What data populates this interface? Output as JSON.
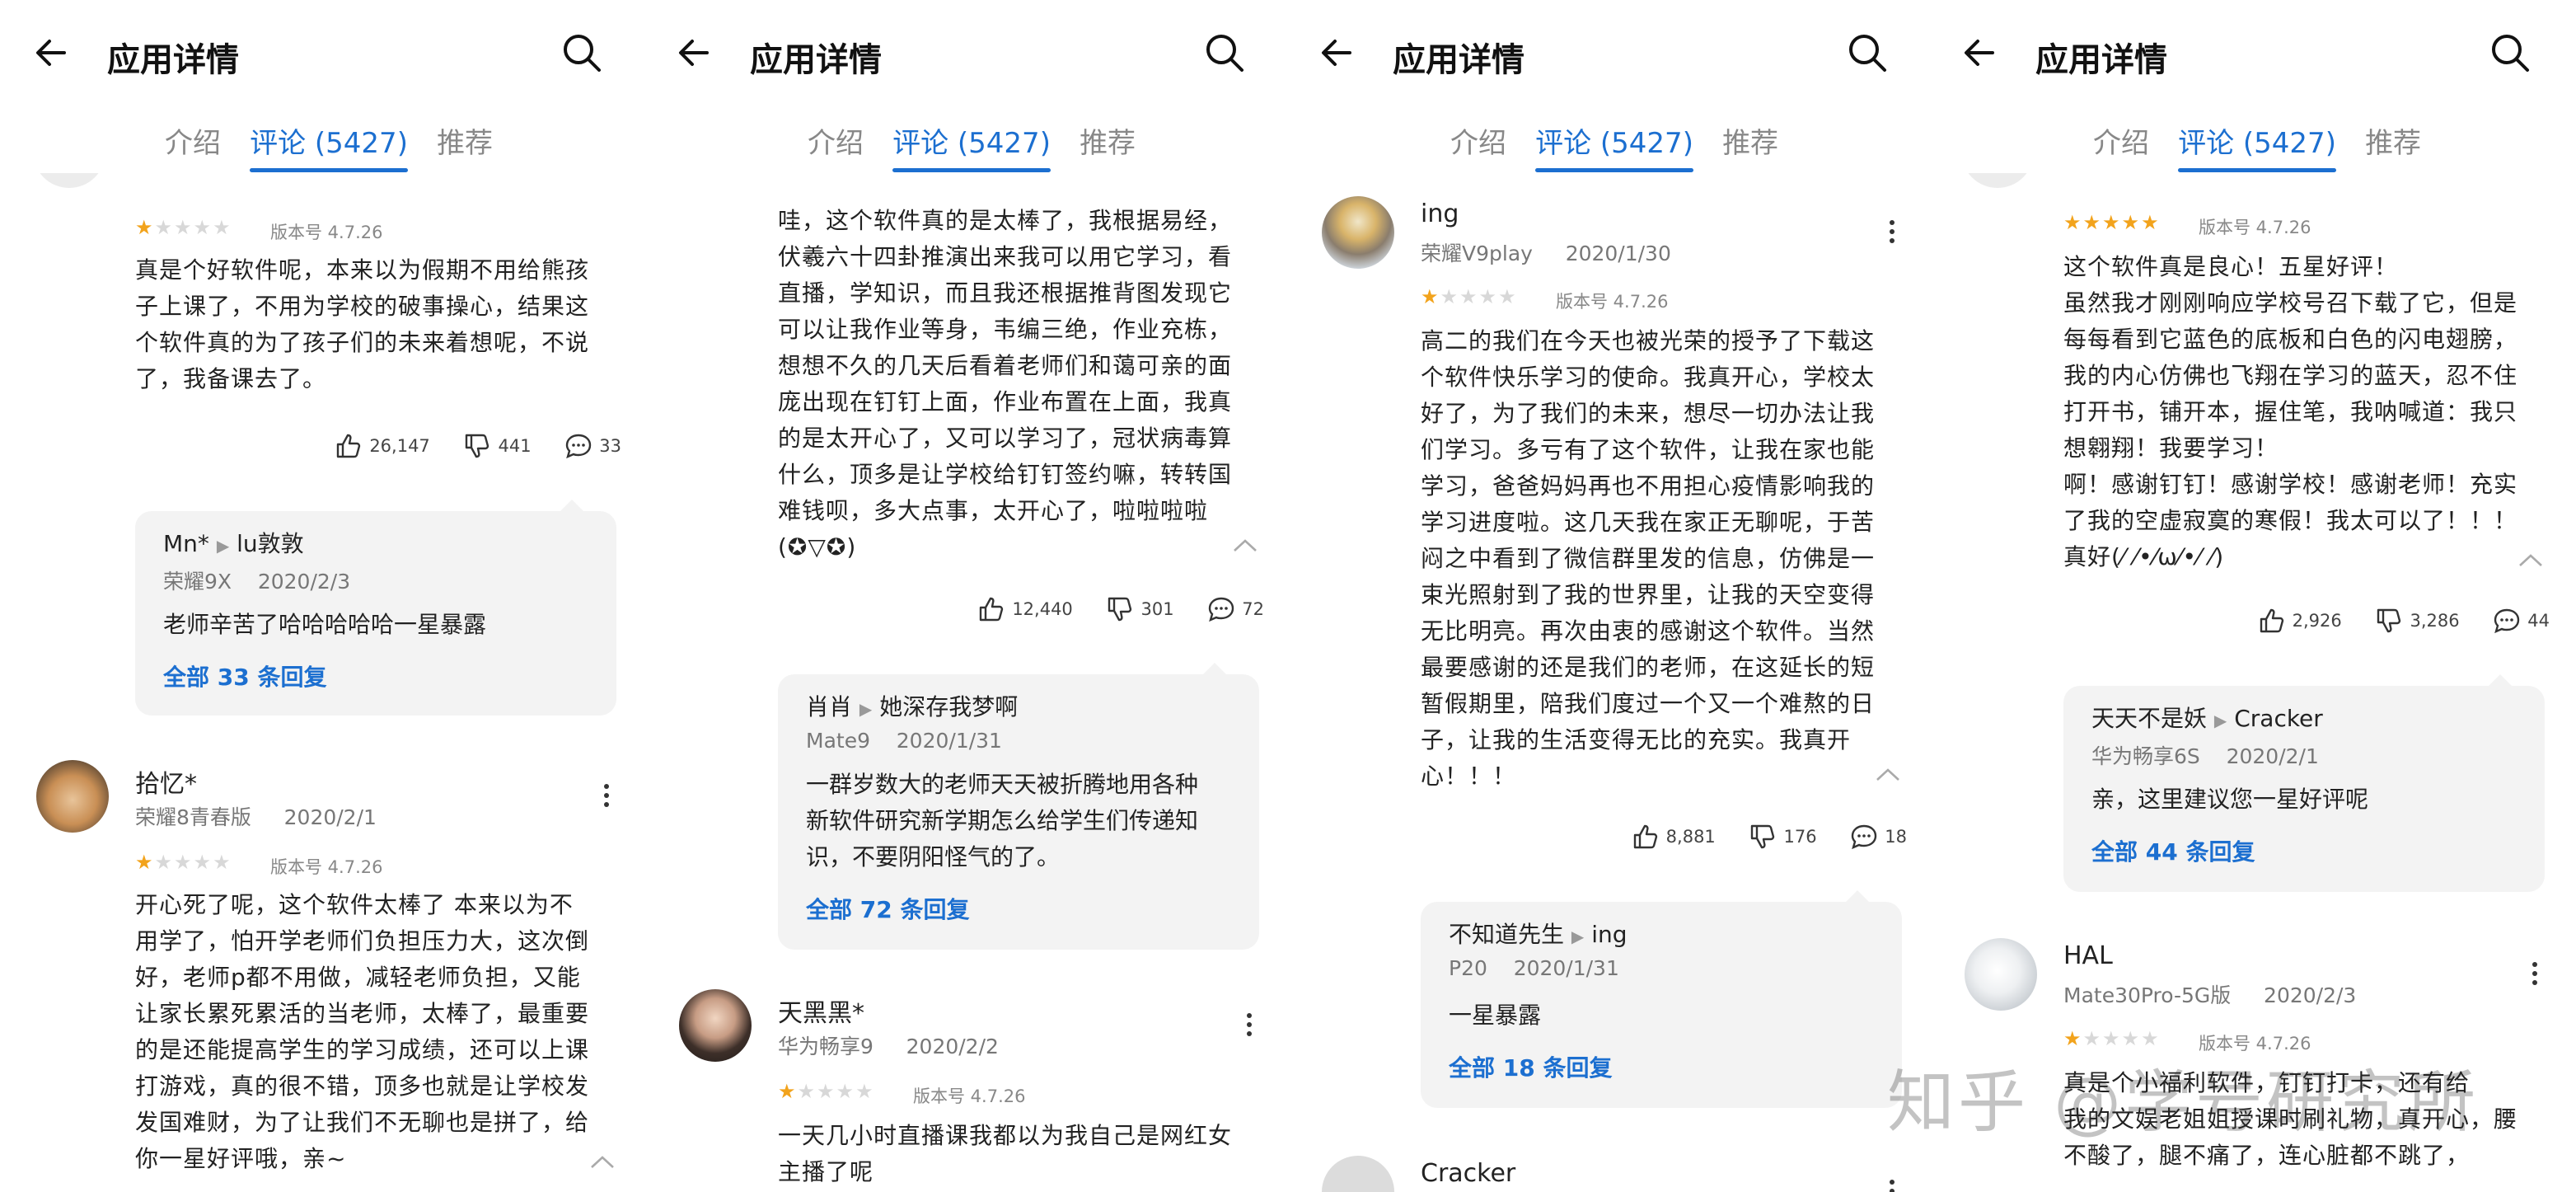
{
  "header": {
    "title": "应用详情"
  },
  "tabs": {
    "intro": "介绍",
    "reviews": "评论 (5427)",
    "recommend": "推荐"
  },
  "colors": {
    "accent": "#1c6fd0",
    "star": "#f2a31c",
    "reply_bg": "#f3f3f3"
  },
  "icons": {
    "back": "arrow-left",
    "search": "magnifier",
    "like": "thumbs-up",
    "dislike": "thumbs-down",
    "comment": "speech-bubble",
    "more": "vertical-dots"
  },
  "watermark": "知乎 @学号研究所",
  "panel1": {
    "r1": {
      "rating": 1,
      "version": "版本号 4.7.26",
      "text": "真是个好软件呢，本来以为假期不用给熊孩\n子上课了，不用为学校的破事操心，结果这\n个软件真的为了孩子们的未来着想呢，不说\n了，我备课去了。",
      "likes": "26,147",
      "dislikes": "441",
      "comments": "33",
      "reply": {
        "from": "Mn*",
        "to": "lu敦敦",
        "device": "荣耀9X",
        "date": "2020/2/3",
        "text": "老师辛苦了哈哈哈哈哈一星暴露",
        "all": "全部 33 条回复"
      }
    },
    "r2": {
      "name": "拾忆*",
      "device": "荣耀8青春版",
      "date": "2020/2/1",
      "rating": 1,
      "version": "版本号 4.7.26",
      "text": "开心死了呢，这个软件太棒了 本来以为不\n用学了，怕开学老师们负担压力大，这次倒\n好，老师p都不用做，减轻老师负担，又能\n让家长累死累活的当老师，太棒了，最重要\n的是还能提高学生的学习成绩，还可以上课\n打游戏，真的很不错，顶多也就是让学校发\n发国难财，为了让我们不无聊也是拼了，给\n你一星好评哦，亲~"
    }
  },
  "panel2": {
    "r1": {
      "text": "哇，这个软件真的是太棒了，我根据易经，\n伏羲六十四卦推演出来我可以用它学习，看\n直播，学知识，而且我还根据推背图发现它\n可以让我作业等身，韦编三绝，作业充栋，\n想想不久的几天后看着老师们和蔼可亲的面\n庞出现在钉钉上面，作业布置在上面，我真\n的是太开心了，又可以学习了，冠状病毒算\n什么，顶多是让学校给钉钉签约嘛，转转国\n难钱呗，多大点事，太开心了，啦啦啦啦\n(✪▽✪)",
      "likes": "12,440",
      "dislikes": "301",
      "comments": "72",
      "reply": {
        "from": "肖肖",
        "to": "她深存我梦啊",
        "device": "Mate9",
        "date": "2020/1/31",
        "text1": "一群岁数大的老师天天被折腾地用各种",
        "text2": "新软件研究新学期怎么给学生们传递知",
        "text3": "识，不要阴阳怪气的了。",
        "all": "全部 72 条回复"
      }
    },
    "r2": {
      "name": "天黑黑*",
      "device": "华为畅享9",
      "date": "2020/2/2",
      "rating": 1,
      "version": "版本号 4.7.26",
      "text": "一天几小时直播课我都以为我自己是网红女\n主播了呢"
    }
  },
  "panel3": {
    "r1": {
      "name": "ing",
      "device": "荣耀V9play",
      "date": "2020/1/30",
      "rating": 1,
      "version": "版本号 4.7.26",
      "text": "高二的我们在今天也被光荣的授予了下载这\n个软件快乐学习的使命。我真开心，学校太\n好了，为了我们的未来，想尽一切办法让我\n们学习。多亏有了这个软件，让我在家也能\n学习，爸爸妈妈再也不用担心疫情影响我的\n学习进度啦。这几天我在家正无聊呢，于苦\n闷之中看到了微信群里发的信息，仿佛是一\n束光照射到了我的世界里，让我的天空变得\n无比明亮。再次由衷的感谢这个软件。当然\n最要感谢的还是我们的老师，在这延长的短\n暂假期里，陪我们度过一个又一个难熬的日\n子，让我的生活变得无比的充实。我真开\n心！！！",
      "likes": "8,881",
      "dislikes": "176",
      "comments": "18",
      "reply": {
        "from": "不知道先生",
        "to": "ing",
        "device": "P20",
        "date": "2020/1/31",
        "text": "一星暴露",
        "all": "全部 18 条回复"
      }
    },
    "r2": {
      "name": "Cracker"
    }
  },
  "panel4": {
    "r1": {
      "rating": 5,
      "version": "版本号 4.7.26",
      "text": "这个软件真是良心！五星好评！\n虽然我才刚刚响应学校号召下载了它，但是\n每每看到它蓝色的底板和白色的闪电翅膀，\n我的内心仿佛也飞翔在学习的蓝天，忍不住\n打开书，铺开本，握住笔，我呐喊道：我只\n想翱翔！我要学习！\n啊！感谢钉钉！感谢学校！感谢老师！充实\n了我的空虚寂寞的寒假！我太可以了！！！\n真好(⁄ ⁄•⁄ω⁄•⁄ ⁄)",
      "likes": "2,926",
      "dislikes": "3,286",
      "comments": "44",
      "reply": {
        "from": "天天不是妖",
        "to": "Cracker",
        "device": "华为畅享6S",
        "date": "2020/2/1",
        "text": "亲，这里建议您一星好评呢",
        "all": "全部 44 条回复"
      }
    },
    "r2": {
      "name": "HAL",
      "device": "Mate30Pro-5G版",
      "date": "2020/2/3",
      "rating": 1,
      "version": "版本号 4.7.26",
      "text": "真是个小福利软件，钉钉打卡，还有给\n我的文娱老姐姐授课时刷礼物，真开心，腰\n不酸了，腿不痛了，连心脏都不跳了，"
    }
  }
}
